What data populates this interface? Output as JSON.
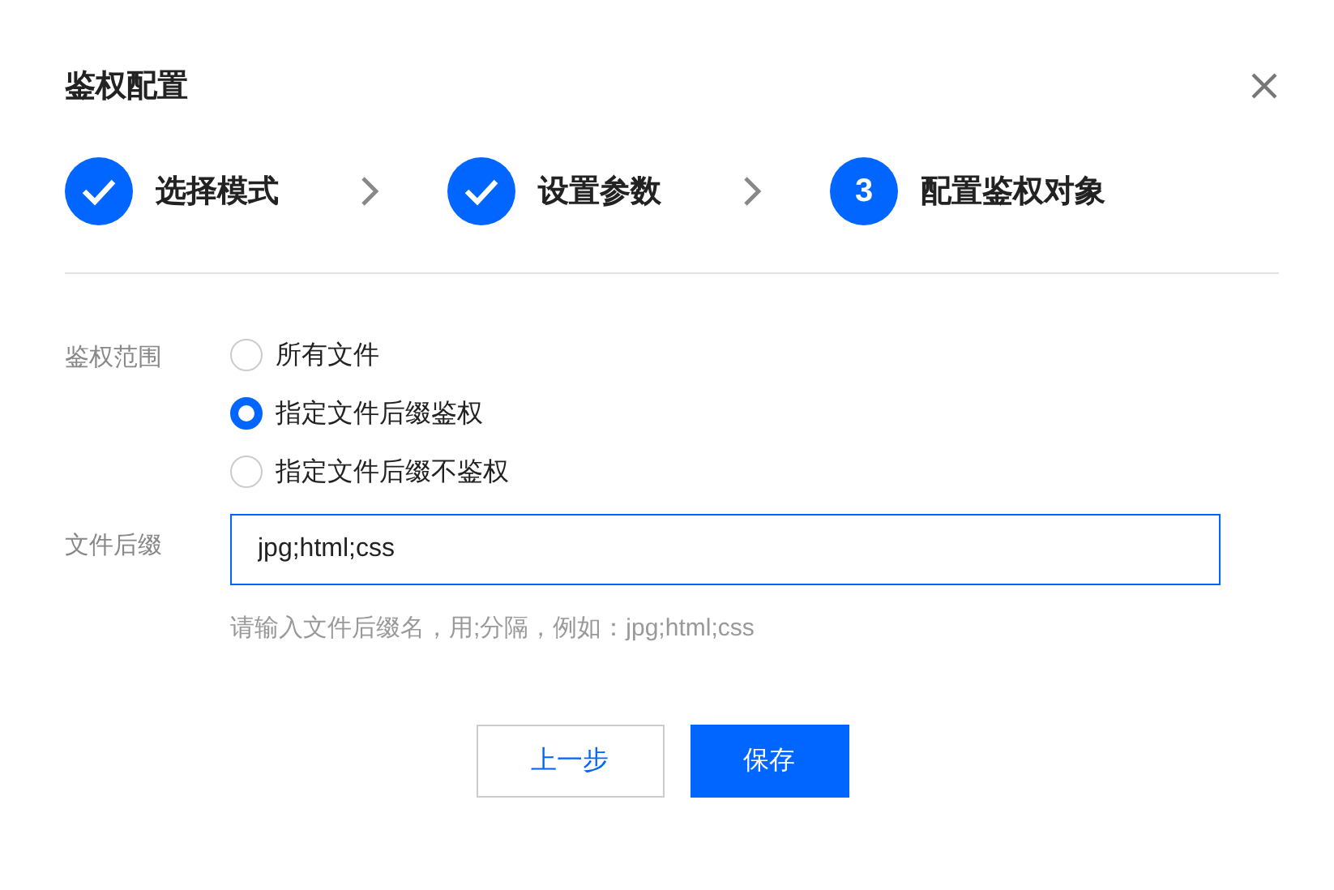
{
  "dialog": {
    "title": "鉴权配置"
  },
  "steps": [
    {
      "label": "选择模式",
      "completed": true
    },
    {
      "label": "设置参数",
      "completed": true
    },
    {
      "label": "配置鉴权对象",
      "completed": false,
      "number": "3"
    }
  ],
  "scope": {
    "label": "鉴权范围",
    "options": [
      {
        "label": "所有文件",
        "selected": false
      },
      {
        "label": "指定文件后缀鉴权",
        "selected": true
      },
      {
        "label": "指定文件后缀不鉴权",
        "selected": false
      }
    ]
  },
  "suffix": {
    "label": "文件后缀",
    "value": "jpg;html;css",
    "hint": "请输入文件后缀名，用;分隔，例如：jpg;html;css"
  },
  "buttons": [
    {
      "label": "上一步",
      "kind": "secondary"
    },
    {
      "label": "保存",
      "kind": "primary"
    }
  ]
}
